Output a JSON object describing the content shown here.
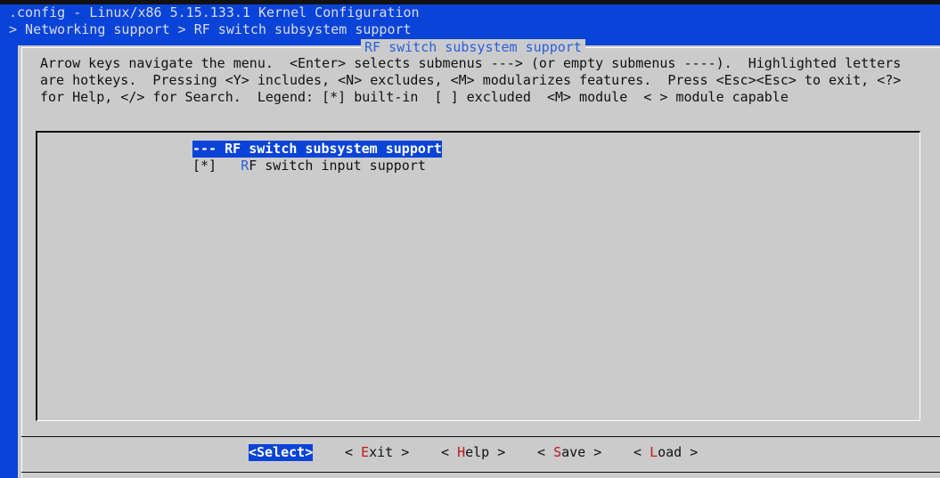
{
  "header": {
    "title": ".config - Linux/x86 5.15.133.1 Kernel Configuration",
    "breadcrumb": "> Networking support > RF switch subsystem support"
  },
  "dialog": {
    "title": "RF switch subsystem support",
    "help": [
      "Arrow keys navigate the menu.  <Enter> selects submenus ---> (or empty submenus ----).  Highlighted letters",
      "are hotkeys.  Pressing <Y> includes, <N> excludes, <M> modularizes features.  Press <Esc><Esc> to exit, <?>",
      "for Help, </> for Search.  Legend: [*] built-in  [ ] excluded  <M> module  < > module capable"
    ],
    "menu": [
      {
        "prefix": "",
        "text": "--- RF switch subsystem support"
      },
      {
        "prefix": "[*]   ",
        "hotkey": "R",
        "text": "F switch input support"
      }
    ],
    "buttons": [
      {
        "label": "<Select>"
      },
      {
        "pre": "< ",
        "hotkey": "E",
        "rest": "xit >"
      },
      {
        "pre": "< ",
        "hotkey": "H",
        "rest": "elp >"
      },
      {
        "pre": "< ",
        "hotkey": "S",
        "rest": "ave >"
      },
      {
        "pre": "< ",
        "hotkey": "L",
        "rest": "oad >"
      }
    ]
  },
  "colors": {
    "background": "#0a43d8",
    "dialog": "#cbcbcb",
    "hotkey_menu": "#2a5fe0",
    "hotkey_button": "#c01818"
  }
}
